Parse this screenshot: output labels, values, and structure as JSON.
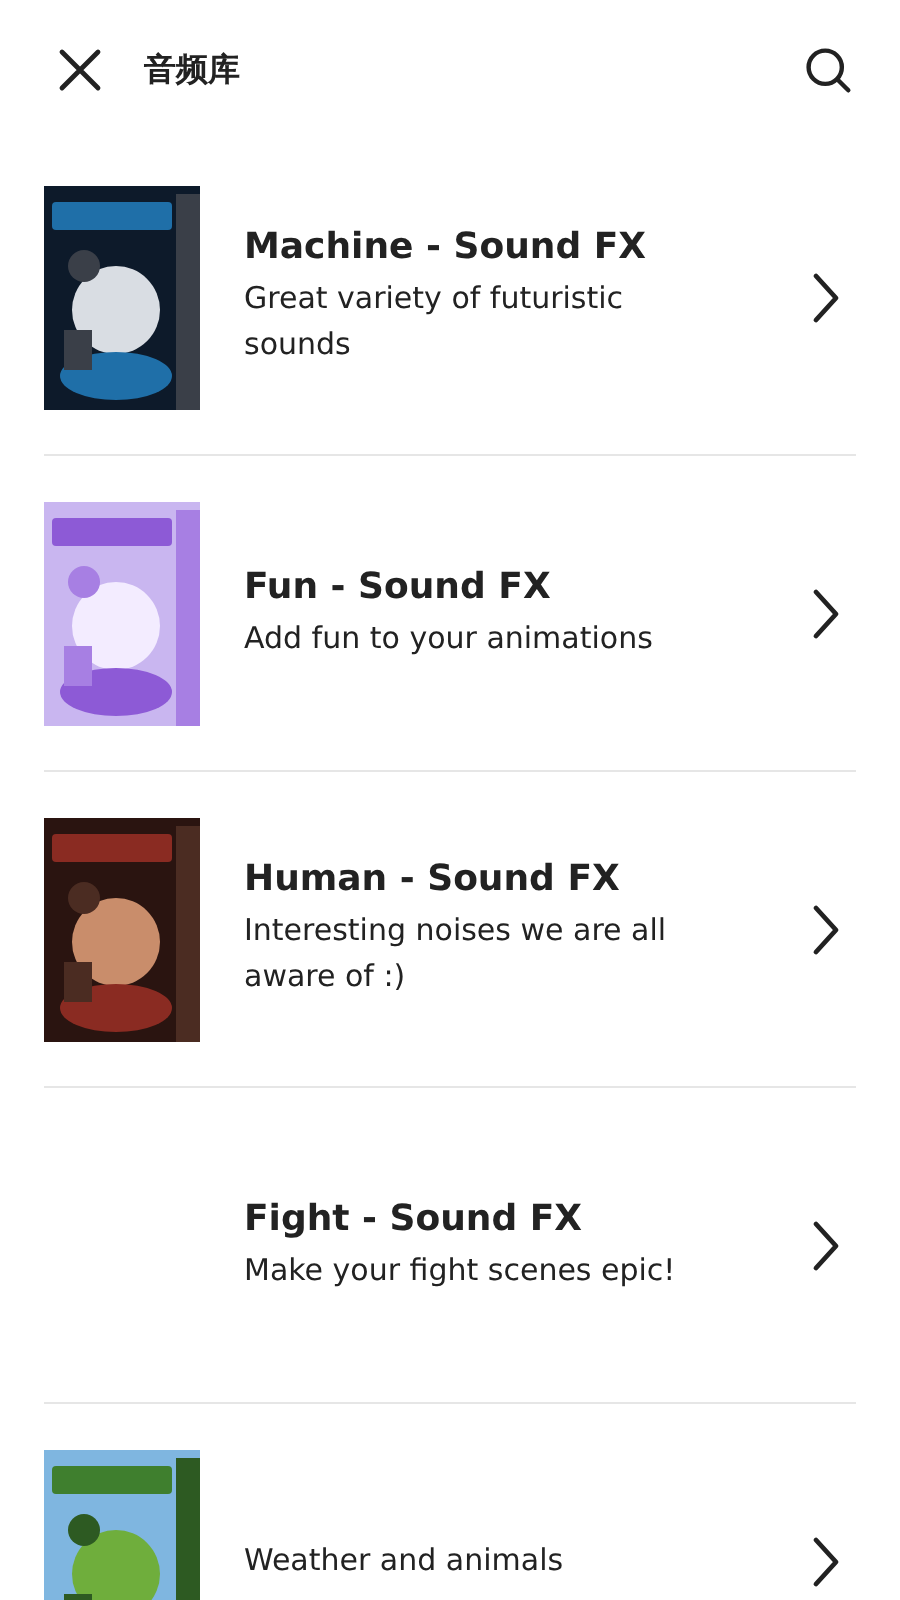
{
  "header": {
    "title": "音频库"
  },
  "items": [
    {
      "image": true,
      "title": "Machine - Sound FX",
      "description": "Great variety of futuristic sounds"
    },
    {
      "image": true,
      "title": "Fun - Sound FX",
      "description": "Add fun to your animations"
    },
    {
      "image": true,
      "title": "Human - Sound FX",
      "description": "Interesting noises we are all aware of :)"
    },
    {
      "image": false,
      "title": "Fight - Sound FX",
      "description": "Make your fight scenes epic!"
    },
    {
      "image": true,
      "description": "Weather and animals"
    }
  ]
}
